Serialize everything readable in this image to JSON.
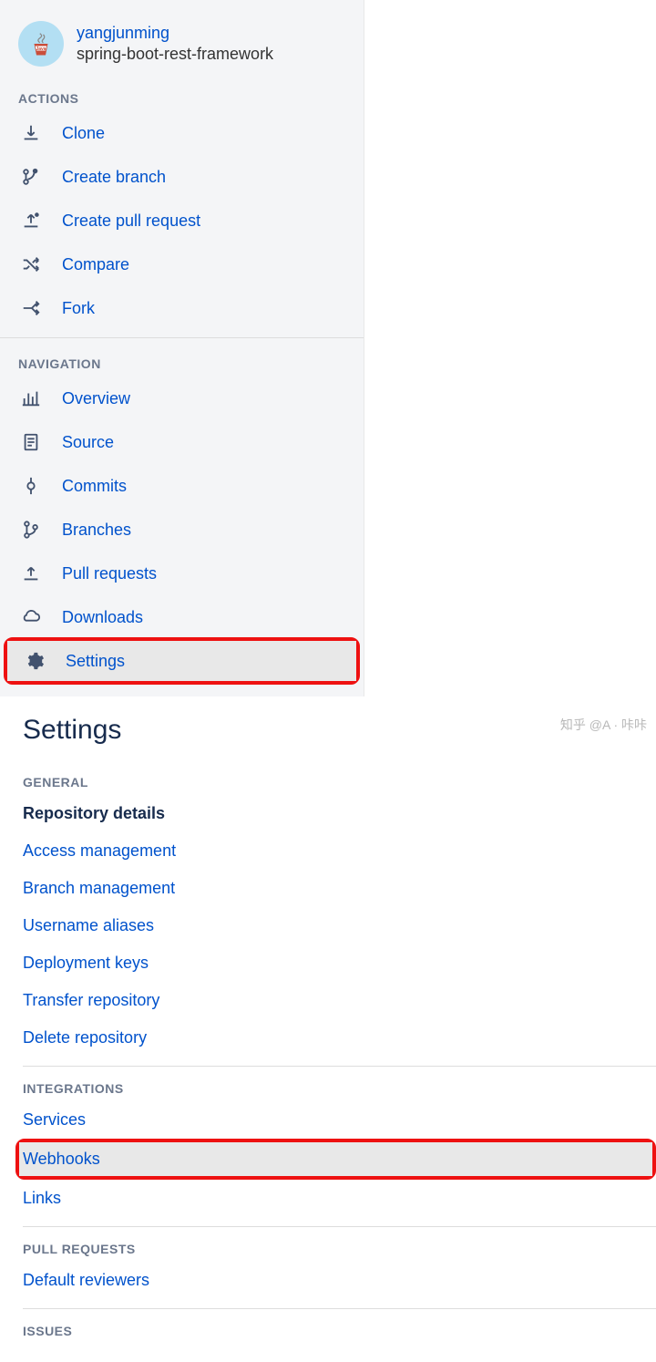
{
  "repo": {
    "owner": "yangjunming",
    "name": "spring-boot-rest-framework"
  },
  "sidebar": {
    "actions_title": "ACTIONS",
    "navigation_title": "NAVIGATION",
    "actions": [
      {
        "label": "Clone"
      },
      {
        "label": "Create branch"
      },
      {
        "label": "Create pull request"
      },
      {
        "label": "Compare"
      },
      {
        "label": "Fork"
      }
    ],
    "navigation": [
      {
        "label": "Overview"
      },
      {
        "label": "Source"
      },
      {
        "label": "Commits"
      },
      {
        "label": "Branches"
      },
      {
        "label": "Pull requests"
      },
      {
        "label": "Downloads"
      },
      {
        "label": "Settings"
      }
    ]
  },
  "main": {
    "title": "Settings",
    "general_title": "GENERAL",
    "integrations_title": "INTEGRATIONS",
    "pull_requests_title": "PULL REQUESTS",
    "issues_title": "ISSUES",
    "general": [
      {
        "label": "Repository details"
      },
      {
        "label": "Access management"
      },
      {
        "label": "Branch management"
      },
      {
        "label": "Username aliases"
      },
      {
        "label": "Deployment keys"
      },
      {
        "label": "Transfer repository"
      },
      {
        "label": "Delete repository"
      }
    ],
    "integrations": [
      {
        "label": "Services"
      },
      {
        "label": "Webhooks"
      },
      {
        "label": "Links"
      }
    ],
    "pull_requests": [
      {
        "label": "Default reviewers"
      }
    ]
  },
  "watermark": "知乎 @A · 咔咔"
}
